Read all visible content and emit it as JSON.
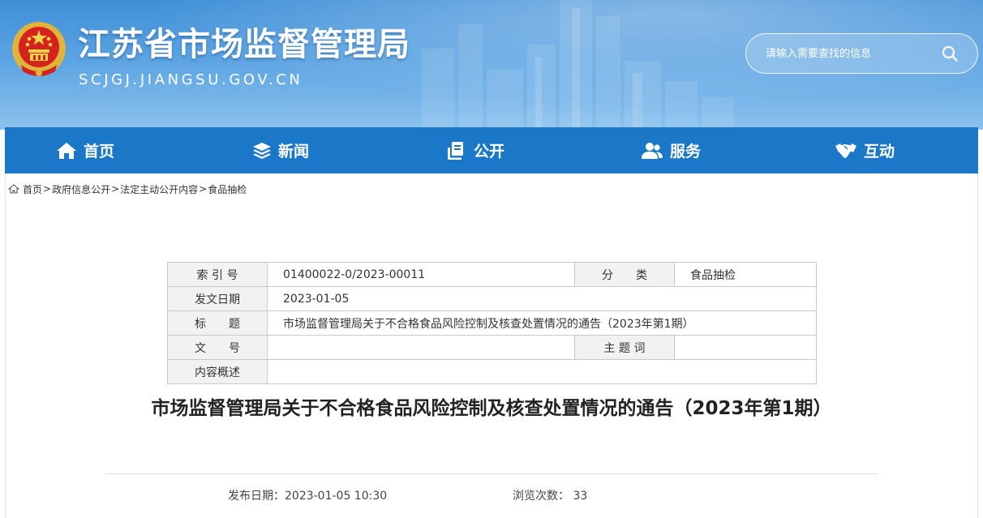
{
  "header": {
    "site_name": "江苏省市场监督管理局",
    "site_domain": "SCJGJ.JIANGSU.GOV.CN",
    "search_placeholder": "请输入需要查找的信息"
  },
  "nav": {
    "items": [
      {
        "label": "首页",
        "icon": "home-icon"
      },
      {
        "label": "新闻",
        "icon": "layers-icon"
      },
      {
        "label": "公开",
        "icon": "documents-icon"
      },
      {
        "label": "服务",
        "icon": "people-icon"
      },
      {
        "label": "互动",
        "icon": "handshake-icon"
      }
    ]
  },
  "breadcrumb": {
    "items": [
      "首页",
      "政府信息公开",
      "法定主动公开内容",
      "食品抽检"
    ],
    "separator": ">"
  },
  "meta": {
    "index_label": "索 引 号",
    "index_value": "01400022-0/2023-00011",
    "category_label": "分　　类",
    "category_value": "食品抽检",
    "date_label": "发文日期",
    "date_value": "2023-01-05",
    "title_label": "标　　题",
    "title_value": "市场监督管理局关于不合格食品风险控制及核查处置情况的通告（2023年第1期）",
    "docno_label": "文　　号",
    "docno_value": "",
    "keywords_label": "主 题 词",
    "keywords_value": "",
    "summary_label": "内容概述",
    "summary_value": ""
  },
  "article": {
    "title": "市场监督管理局关于不合格食品风险控制及核查处置情况的通告（2023年第1期）",
    "publish_label": "发布日期：",
    "publish_value": "2023-01-05 10:30",
    "views_label": "浏览次数：",
    "views_value": "33"
  },
  "colors": {
    "nav_bg": "#1b78c9",
    "header_top": "#3f8fd7",
    "table_label_bg": "#f2f2f2"
  }
}
